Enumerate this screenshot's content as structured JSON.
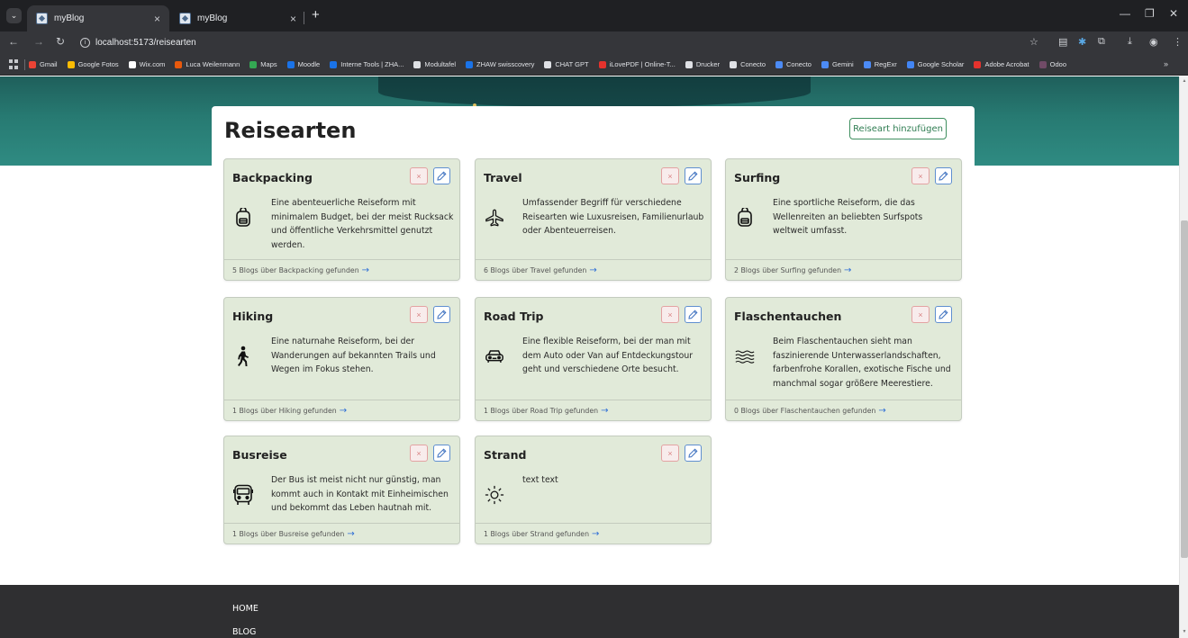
{
  "browser": {
    "tabs": [
      {
        "title": "myBlog",
        "close": "×"
      },
      {
        "title": "myBlog",
        "close": "×"
      }
    ],
    "new_tab": "+",
    "url": "localhost:5173/reisearten",
    "window_controls": {
      "minimize": "—",
      "restore": "❐",
      "close": "✕"
    },
    "bookmarks": [
      {
        "label": "Gmail",
        "color": "#ea4335"
      },
      {
        "label": "Google Fotos",
        "color": "#fbbc04"
      },
      {
        "label": "Wix.com",
        "color": "#ffffff"
      },
      {
        "label": "Luca Weilenmann",
        "color": "#e8590c"
      },
      {
        "label": "Maps",
        "color": "#34a853"
      },
      {
        "label": "Moodle",
        "color": "#1a73e8"
      },
      {
        "label": "Interne Tools | ZHA...",
        "color": "#1a73e8"
      },
      {
        "label": "Modultafel",
        "color": "#dfe1e5"
      },
      {
        "label": "ZHAW swisscovery",
        "color": "#1a73e8"
      },
      {
        "label": "CHAT GPT",
        "color": "#dfe1e5"
      },
      {
        "label": "iLovePDF | Online-T...",
        "color": "#e5322d"
      },
      {
        "label": "Drucker",
        "color": "#dfe1e5"
      },
      {
        "label": "Conecto",
        "color": "#dfe1e5"
      },
      {
        "label": "Conecto",
        "color": "#4c8bf5"
      },
      {
        "label": "Gemini",
        "color": "#4c8bf5"
      },
      {
        "label": "RegExr",
        "color": "#4c8bf5"
      },
      {
        "label": "Google Scholar",
        "color": "#4285f4"
      },
      {
        "label": "Adobe Acrobat",
        "color": "#e5322d"
      },
      {
        "label": "Odoo",
        "color": "#714b67"
      }
    ],
    "bookmarks_more": "»"
  },
  "page": {
    "title": "Reisearten",
    "add_button": "Reiseart hinzufügen",
    "delete_symbol": "×",
    "cards": [
      {
        "title": "Backpacking",
        "icon": "backpack-icon",
        "description": "Eine abenteuerliche Reiseform mit minimalem Budget, bei der meist Rucksack und öffentliche Verkehrsmittel genutzt werden.",
        "footer": "5 Blogs über Backpacking gefunden",
        "arrow": "→"
      },
      {
        "title": "Travel",
        "icon": "airplane-icon",
        "description": "Umfassender Begriff für verschiedene Reisearten wie Luxusreisen, Familienurlaub oder Abenteuerreisen.",
        "footer": "6 Blogs über Travel gefunden",
        "arrow": "→"
      },
      {
        "title": "Surfing",
        "icon": "backpack-icon",
        "description": "Eine sportliche Reiseform, die das Wellenreiten an beliebten Surfspots weltweit umfasst.",
        "footer": "2 Blogs über Surfing gefunden",
        "arrow": "→"
      },
      {
        "title": "Hiking",
        "icon": "hiker-icon",
        "description": "Eine naturnahe Reiseform, bei der Wanderungen auf bekannten Trails und Wegen im Fokus stehen.",
        "footer": "1 Blogs über Hiking gefunden",
        "arrow": "→"
      },
      {
        "title": "Road Trip",
        "icon": "car-icon",
        "description": "Eine flexible Reiseform, bei der man mit dem Auto oder Van auf Entdeckungstour geht und verschiedene Orte besucht.",
        "footer": "1 Blogs über Road Trip gefunden",
        "arrow": "→"
      },
      {
        "title": "Flaschentauchen",
        "icon": "waves-icon",
        "description": "Beim Flaschentauchen sieht man faszinierende Unterwasserlandschaften, farbenfrohe Korallen, exotische Fische und manchmal sogar größere Meerestiere.",
        "footer": "0 Blogs über Flaschentauchen gefunden",
        "arrow": "→"
      },
      {
        "title": "Busreise",
        "icon": "bus-icon",
        "description": "Der Bus ist meist nicht nur günstig, man kommt auch in Kontakt mit Einheimischen und bekommt das Leben hautnah mit.",
        "footer": "1 Blogs über Busreise gefunden",
        "arrow": "→"
      },
      {
        "title": "Strand",
        "icon": "sun-icon",
        "description": "text text",
        "footer": "1 Blogs über Strand gefunden",
        "arrow": "→"
      }
    ]
  },
  "footer": {
    "links": [
      "HOME",
      "BLOG"
    ]
  },
  "colors": {
    "card_bg": "#e1ead9",
    "add_button_accent": "#2f7d52",
    "delete_accent": "#d98585",
    "edit_accent": "#5f8fd0",
    "link_arrow": "#2f6fd6",
    "footer_bg": "#2f2f31"
  }
}
